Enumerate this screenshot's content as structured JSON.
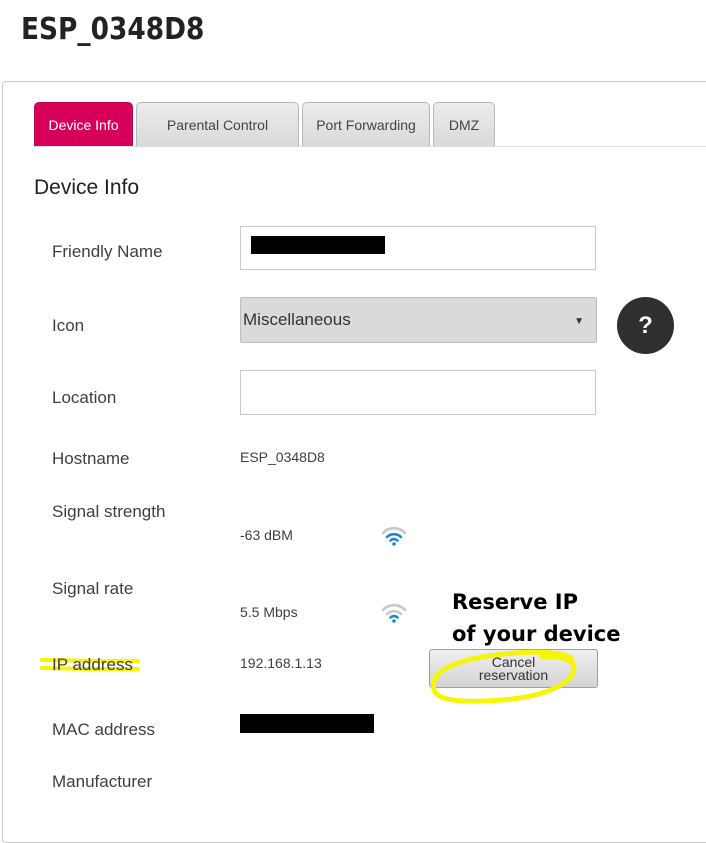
{
  "page": {
    "title": "ESP_0348D8"
  },
  "tabs": [
    {
      "label": "Device Info",
      "active": true
    },
    {
      "label": "Parental Control",
      "active": false
    },
    {
      "label": "Port Forwarding",
      "active": false
    },
    {
      "label": "DMZ",
      "active": false
    }
  ],
  "section": {
    "title": "Device Info"
  },
  "fields": {
    "friendly_name": {
      "label": "Friendly Name",
      "value": ""
    },
    "icon": {
      "label": "Icon",
      "selected": "Miscellaneous"
    },
    "location": {
      "label": "Location",
      "value": ""
    },
    "hostname": {
      "label": "Hostname",
      "value": "ESP_0348D8"
    },
    "signal_strength": {
      "label": "Signal strength",
      "value": "-63 dBM"
    },
    "signal_rate": {
      "label": "Signal rate",
      "value": "5.5 Mbps"
    },
    "ip_address": {
      "label": "IP address",
      "value": "192.168.1.13"
    },
    "mac_address": {
      "label": "MAC address",
      "value": ""
    },
    "manufacturer": {
      "label": "Manufacturer",
      "value": ""
    }
  },
  "buttons": {
    "cancel_reservation_line1": "Cancel",
    "cancel_reservation_line2": "reservation",
    "help": "?"
  },
  "annotation": {
    "line1": "Reserve IP",
    "line2": "of your device",
    "color": "#f5f50a"
  },
  "colors": {
    "accent": "#d6005a",
    "redaction": "#000000",
    "wifi": "#1e88c8"
  },
  "icons": {
    "help": "question-icon",
    "signal": "wifi-signal-icon",
    "caret": "caret-down-icon"
  }
}
